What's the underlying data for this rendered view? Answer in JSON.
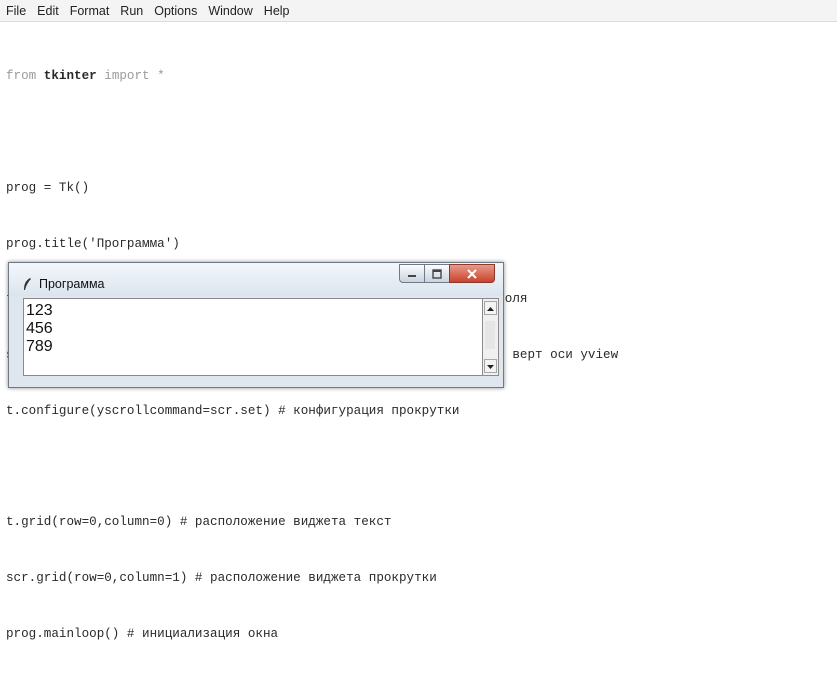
{
  "menu": [
    "File",
    "Edit",
    "Format",
    "Run",
    "Options",
    "Window",
    "Help"
  ],
  "code": {
    "line1_from": "from ",
    "line1_module": "tkinter",
    "line1_rest": " import *",
    "line2": "prog = Tk()",
    "line3": "prog.title('Программа')",
    "line4": "t = Text(prog,width=40,height=3,font='14') # создание текстового поля",
    "line5": "scr = Scrollbar(prog,command=t.yview) # полоса прокрутки по полю t верт оси yview",
    "line6": "t.configure(yscrollcommand=scr.set) # конфигурация прокрутки",
    "line7": "t.grid(row=0,column=0) # расположение виджета текст",
    "line8": "scr.grid(row=0,column=1) # расположение виджета прокрутки",
    "line9": "prog.mainloop() # инициализация окна"
  },
  "window": {
    "title": "Программа",
    "text_lines": [
      "123",
      "456",
      "789"
    ]
  },
  "icons": [
    "feather-icon",
    "minimize-icon",
    "maximize-icon",
    "close-icon",
    "scroll-up-icon",
    "scroll-down-icon"
  ]
}
